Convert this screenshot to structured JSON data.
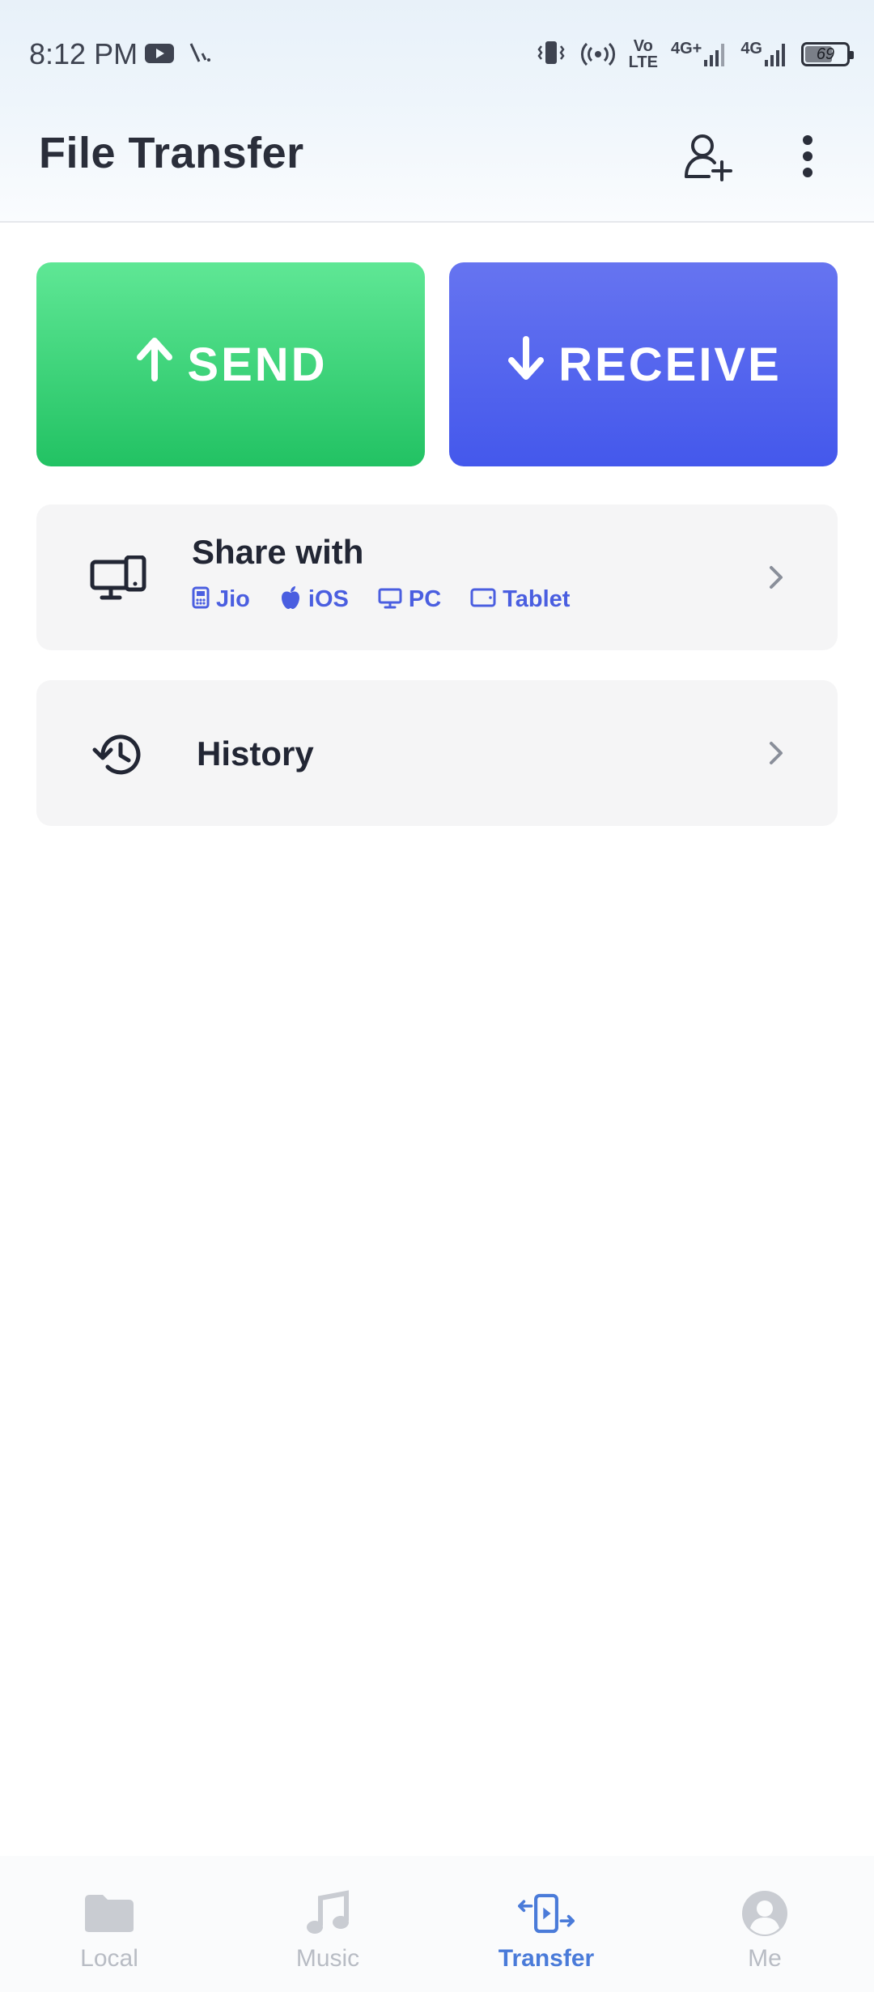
{
  "status_bar": {
    "time": "8:12 PM",
    "network_labels": [
      "Vo",
      "LTE",
      "4G+",
      "4G"
    ],
    "battery_text": "69",
    "battery_level": 0.69
  },
  "app_bar": {
    "title": "File Transfer",
    "icons": [
      "add-user-icon",
      "more-vert-icon"
    ]
  },
  "actions": {
    "send_label": "SEND",
    "receive_label": "RECEIVE"
  },
  "share": {
    "title": "Share with",
    "platforms": [
      {
        "label": "Jio",
        "icon": "jio-phone-icon"
      },
      {
        "label": "iOS",
        "icon": "apple-icon"
      },
      {
        "label": "PC",
        "icon": "pc-icon"
      },
      {
        "label": "Tablet",
        "icon": "tablet-icon"
      }
    ]
  },
  "history": {
    "title": "History"
  },
  "bottom_nav": {
    "items": [
      {
        "label": "Local",
        "icon": "folder-icon"
      },
      {
        "label": "Music",
        "icon": "music-note-icon"
      },
      {
        "label": "Transfer",
        "icon": "transfer-icon"
      },
      {
        "label": "Me",
        "icon": "profile-icon"
      }
    ],
    "active": "Transfer"
  },
  "colors": {
    "send": "#22c263",
    "receive": "#4458ec",
    "platform_text": "#4a5ee0",
    "nav_active": "#4a7bd9",
    "nav_inactive": "#b8bcc4"
  }
}
